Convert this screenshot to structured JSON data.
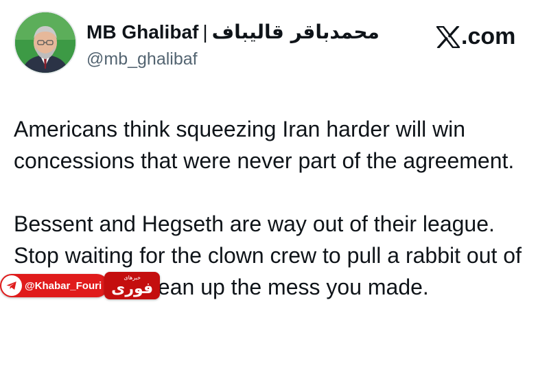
{
  "header": {
    "display_name": "MB Ghalibaf",
    "separator": "|",
    "display_name_fa": "محمدباقر قالیباف",
    "handle": "@mb_ghalibaf",
    "avatar_icon": "profile-photo"
  },
  "brand": {
    "source_text": ".com",
    "logo_icon": "x-logo-icon"
  },
  "tweet": {
    "paragraphs": [
      "Americans think squeezing Iran harder will win concessions that were never part of the agreement.",
      "Bessent and Hegseth are way out of their league. Stop waiting for the clown crew to pull a rabbit out of their hat and clean up the mess you made."
    ]
  },
  "watermark": {
    "channel": "@Khabar_Fouri",
    "logo_text": "فوری",
    "logo_subtext": "خبرهای",
    "icon": "telegram-icon",
    "color": "#e01b1b"
  }
}
